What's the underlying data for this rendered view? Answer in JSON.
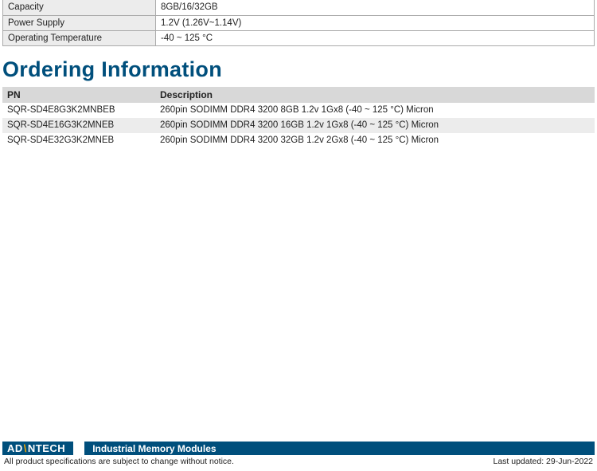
{
  "spec_table": {
    "rows": [
      {
        "label": "Capacity",
        "value": "8GB/16/32GB"
      },
      {
        "label": "Power Supply",
        "value": "1.2V (1.26V~1.14V)"
      },
      {
        "label": "Operating Temperature",
        "value": "-40 ~ 125 °C"
      }
    ]
  },
  "ordering": {
    "heading": "Ordering Information",
    "columns": {
      "pn": "PN",
      "desc": "Description"
    },
    "rows": [
      {
        "pn": "SQR-SD4E8G3K2MNBEB",
        "desc": "260pin SODIMM DDR4 3200 8GB 1.2v 1Gx8 (-40 ~ 125 °C) Micron"
      },
      {
        "pn": "SQR-SD4E16G3K2MNEB",
        "desc": "260pin SODIMM DDR4 3200 16GB 1.2v 1Gx8 (-40 ~ 125 °C) Micron"
      },
      {
        "pn": "SQR-SD4E32G3K2MNEB",
        "desc": "260pin SODIMM DDR4 3200 32GB 1.2v 2Gx8 (-40 ~ 125 °C) Micron"
      }
    ]
  },
  "footer": {
    "brand_left": "AD",
    "brand_right": "NTECH",
    "category": "Industrial Memory Modules",
    "disclaimer": "All product specifications are subject to change without notice.",
    "last_updated": "Last updated: 29-Jun-2022"
  }
}
